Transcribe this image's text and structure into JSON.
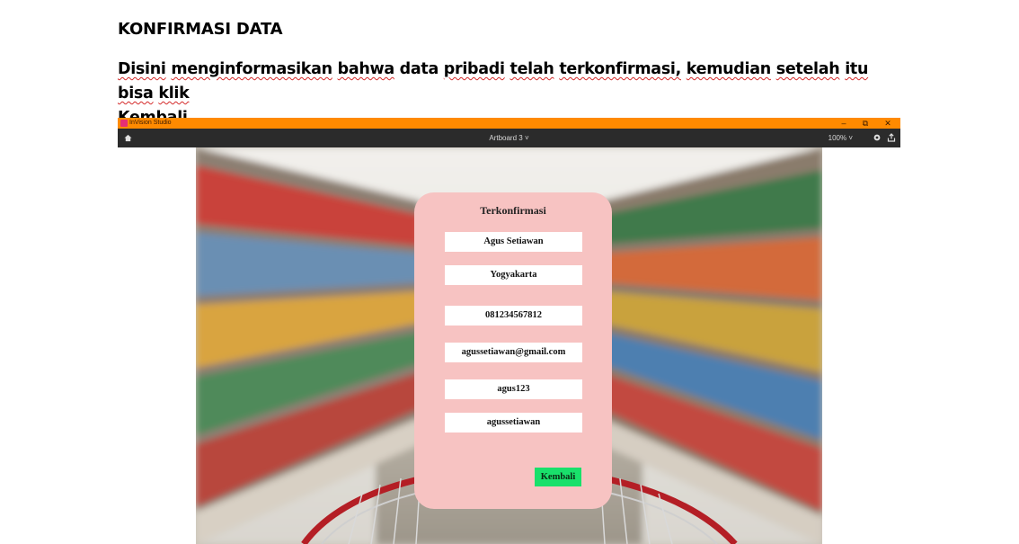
{
  "document": {
    "heading": "KONFIRMASI DATA",
    "paragraph_words": [
      "Disini",
      "menginformasikan",
      "bahwa",
      "data",
      "pribadi",
      "telah",
      "terkonfirmasi,",
      "kemudian",
      "setelah",
      "itu",
      "bisa",
      "klik",
      "Kembali"
    ]
  },
  "window": {
    "app_title": "InVision Studio",
    "artboard_label": "Artboard 3",
    "zoom_label": "100%",
    "accent_color": "#ff8a00",
    "toolbar_color": "#2b2b2b"
  },
  "card": {
    "title": "Terkonfirmasi",
    "background": "#f7c3c2",
    "fields": {
      "name": "Agus Setiawan",
      "city": "Yogyakarta",
      "phone": "081234567812",
      "email": "agussetiawan@gmail.com",
      "password": "agus123",
      "username": "agussetiawan"
    },
    "back_button_label": "Kembali",
    "back_button_color": "#19e06b"
  }
}
